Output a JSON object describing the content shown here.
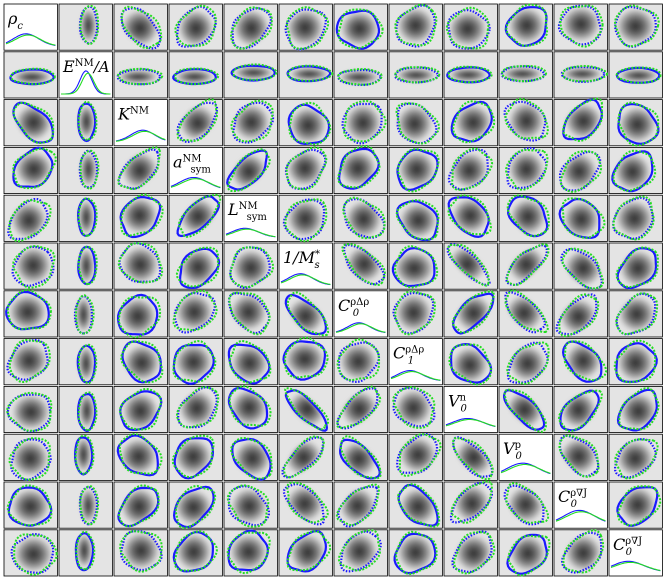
{
  "chart_data": {
    "type": "corner",
    "description_free": true,
    "parameters": [
      {
        "base": "ρ",
        "sub": "c",
        "sup": ""
      },
      {
        "base": "E",
        "sub": "",
        "sup": "NM",
        "tail": "/A"
      },
      {
        "base": "K",
        "sub": "",
        "sup": "NM"
      },
      {
        "base": "a",
        "sub": "sym",
        "sup": "NM"
      },
      {
        "base": "L",
        "sub": "sym",
        "sup": "NM"
      },
      {
        "base": "1/M",
        "sub": "s",
        "sup": "*"
      },
      {
        "base": "C",
        "sub": "0",
        "sup": "ρΔρ"
      },
      {
        "base": "C",
        "sub": "1",
        "sup": "ρΔρ"
      },
      {
        "base": "V",
        "sub": "0",
        "sup": "n"
      },
      {
        "base": "V",
        "sub": "0",
        "sup": "p"
      },
      {
        "base": "C",
        "sub": "0",
        "sup": "ρ∇J"
      },
      {
        "base": "C",
        "sub": "0",
        "sup": "ρ∇J"
      }
    ],
    "correlations": [
      [
        1,
        0.1,
        -0.45,
        0.25,
        0.3,
        0.1,
        0.05,
        0.15,
        0.05,
        0.1,
        0.0,
        0.0
      ],
      [
        0.1,
        1,
        0.0,
        0.05,
        0.05,
        0.0,
        0.0,
        0.0,
        0.0,
        0.0,
        0.0,
        0.0
      ],
      [
        -0.45,
        0.0,
        1,
        0.5,
        0.2,
        -0.1,
        0.1,
        -0.2,
        0.2,
        -0.2,
        0.4,
        -0.1
      ],
      [
        0.25,
        0.05,
        0.5,
        1,
        0.6,
        0.3,
        0.2,
        0.1,
        0.3,
        0.2,
        0.35,
        0.2
      ],
      [
        0.3,
        0.05,
        0.2,
        0.6,
        1,
        0.1,
        -0.3,
        -0.2,
        -0.3,
        -0.3,
        -0.2,
        0.1
      ],
      [
        0.1,
        0.0,
        -0.1,
        0.3,
        0.1,
        1,
        -0.6,
        0.05,
        -0.8,
        0.7,
        -0.5,
        0.3
      ],
      [
        0.05,
        0.0,
        0.1,
        0.2,
        -0.3,
        -0.6,
        1,
        0.1,
        0.6,
        -0.6,
        0.5,
        0.3
      ],
      [
        0.15,
        0.0,
        -0.2,
        0.1,
        -0.2,
        0.05,
        0.1,
        1,
        -0.2,
        0.3,
        -0.4,
        0.1
      ],
      [
        0.05,
        0.0,
        0.2,
        0.3,
        -0.3,
        -0.8,
        0.6,
        -0.2,
        1,
        -0.7,
        0.5,
        0.3
      ],
      [
        0.1,
        0.0,
        -0.2,
        0.2,
        -0.3,
        0.7,
        -0.6,
        0.3,
        -0.7,
        1,
        -0.45,
        0.3
      ],
      [
        0.0,
        0.0,
        0.4,
        0.35,
        -0.2,
        -0.5,
        0.5,
        -0.4,
        0.5,
        -0.45,
        1,
        0.3
      ],
      [
        0.0,
        0.0,
        -0.1,
        0.2,
        0.1,
        0.3,
        0.3,
        0.1,
        0.3,
        0.3,
        0.3,
        1
      ]
    ],
    "series": [
      {
        "name": "",
        "color": "#1a1aff",
        "style": "solid"
      },
      {
        "name": "",
        "color": "#22dd22",
        "style": "dotted"
      }
    ],
    "grid": false,
    "legend": "none"
  }
}
